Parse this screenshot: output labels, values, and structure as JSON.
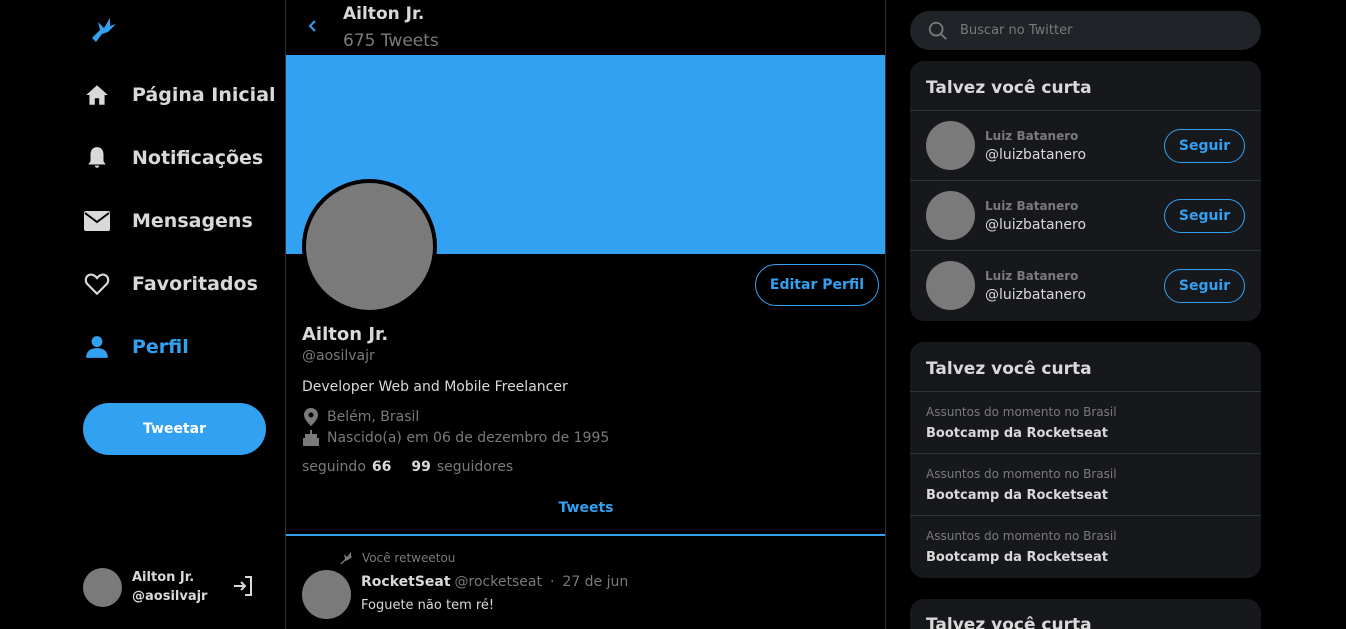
{
  "nav": {
    "items": [
      {
        "label": "Página Inicial",
        "icon": "home-icon"
      },
      {
        "label": "Notificações",
        "icon": "bell-icon"
      },
      {
        "label": "Mensagens",
        "icon": "envelope-icon"
      },
      {
        "label": "Favoritados",
        "icon": "heart-icon"
      },
      {
        "label": "Perfil",
        "icon": "person-icon"
      }
    ],
    "tweet_button": "Tweetar",
    "user": {
      "name": "Ailton Jr.",
      "handle": "@aosilvajr"
    }
  },
  "header": {
    "name": "Ailton Jr.",
    "tweet_count": "675 Tweets"
  },
  "profile": {
    "edit_button": "Editar Perfil",
    "name": "Ailton Jr.",
    "handle": "@aosilvajr",
    "bio": "Developer Web and Mobile Freelancer",
    "location": "Belém, Brasil",
    "birth": "Nascido(a) em 06 de dezembro de 1995",
    "following_label": "seguindo",
    "following_count": "66",
    "followers_count": "99",
    "followers_label": "seguidores"
  },
  "tabs": {
    "tweets": "Tweets"
  },
  "tweet": {
    "retweet_label": "Você retweetou",
    "author": "RocketSeat",
    "username": "@rocketseat",
    "separator": "·",
    "date": "27 de jun",
    "text": "Foguete não tem ré!"
  },
  "search": {
    "placeholder": "Buscar no Twitter"
  },
  "follow_card": {
    "title": "Talvez você curta",
    "button": "Seguir",
    "users": [
      {
        "name": "Luiz Batanero",
        "handle": "@luizbatanero"
      },
      {
        "name": "Luiz Batanero",
        "handle": "@luizbatanero"
      },
      {
        "name": "Luiz Batanero",
        "handle": "@luizbatanero"
      }
    ]
  },
  "trends_card": {
    "title": "Talvez você curta",
    "items": [
      {
        "context": "Assuntos do momento no Brasil",
        "topic": "Bootcamp da Rocketseat"
      },
      {
        "context": "Assuntos do momento no Brasil",
        "topic": "Bootcamp da Rocketseat"
      },
      {
        "context": "Assuntos do momento no Brasil",
        "topic": "Bootcamp da Rocketseat"
      }
    ]
  },
  "third_card": {
    "title": "Talvez você curta"
  },
  "colors": {
    "accent": "#33a1f2",
    "background": "#000000",
    "card": "#16181c",
    "muted": "#7a7a7a"
  }
}
